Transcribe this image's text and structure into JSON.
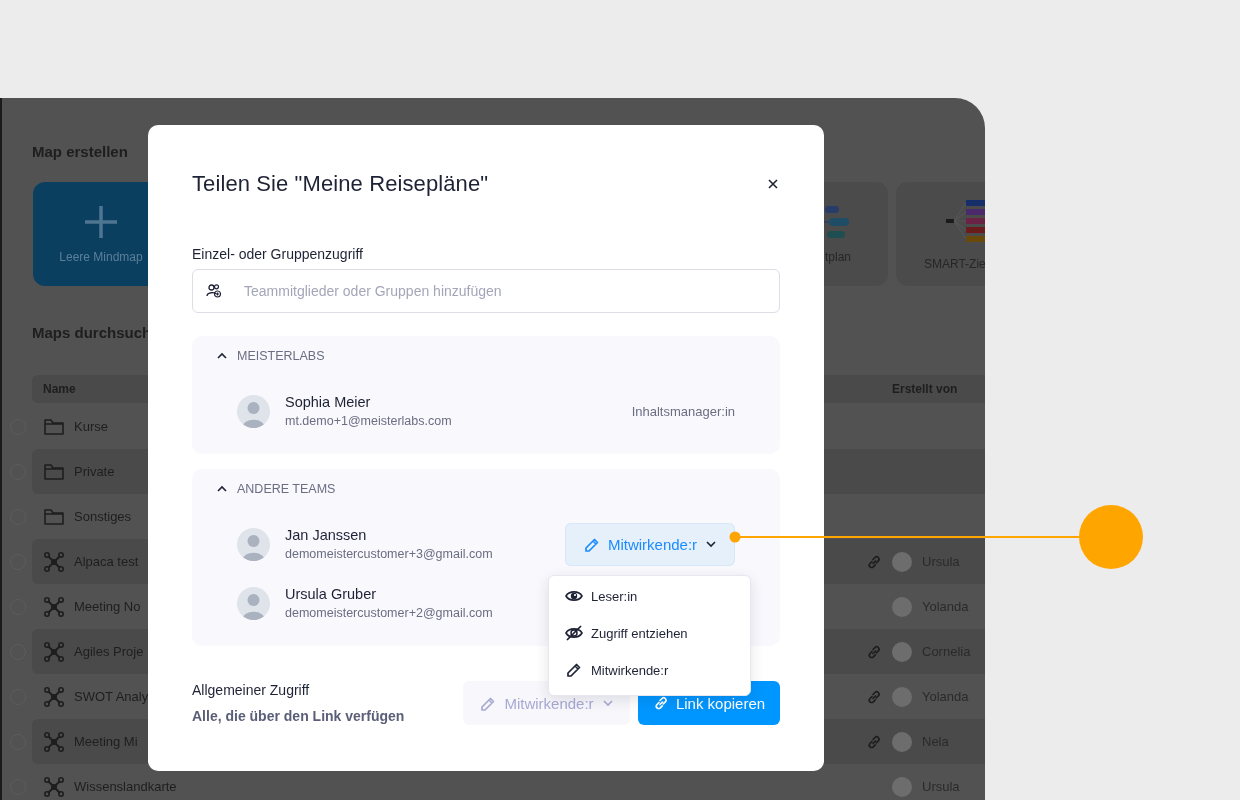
{
  "background_app": {
    "create_title": "Map erstellen",
    "templates": [
      {
        "kind": "blank",
        "label": "Leere Mindmap"
      },
      {
        "kind": "plan",
        "label": "tplan"
      },
      {
        "kind": "smart",
        "label": "SMART-Zie"
      }
    ],
    "browse_title": "Maps durchsuch",
    "table": {
      "columns": [
        "Name",
        "Erstellt von"
      ],
      "rows": [
        {
          "kind": "folder",
          "name": "Kurse",
          "shared": false,
          "checked": false
        },
        {
          "kind": "folder",
          "name": "Private",
          "shared": false,
          "checked": false
        },
        {
          "kind": "folder",
          "name": "Sonstiges",
          "shared": false,
          "checked": false
        },
        {
          "kind": "map",
          "name": "Alpaca test",
          "shared": true,
          "creator": "Ursula",
          "checked": false
        },
        {
          "kind": "map",
          "name": "Meeting No",
          "shared": false,
          "creator": "Yolanda",
          "checked": false
        },
        {
          "kind": "map",
          "name": "Agiles Proje",
          "shared": true,
          "creator": "Cornelia",
          "checked": false
        },
        {
          "kind": "map",
          "name": "SWOT Analy",
          "shared": true,
          "creator": "Yolanda",
          "checked": false
        },
        {
          "kind": "map",
          "name": "Meeting Mi",
          "shared": true,
          "creator": "Nela",
          "checked": false
        },
        {
          "kind": "map",
          "name": "Wissenslandkarte",
          "shared": false,
          "creator": "Ursula",
          "checked": false
        }
      ]
    }
  },
  "dialog": {
    "title": "Teilen Sie \"Meine Reisepläne\"",
    "access_label": "Einzel- oder Gruppenzugriff",
    "search": {
      "placeholder": "Teammitglieder oder Gruppen hinzufügen"
    },
    "groups": [
      {
        "name": "MEISTERLABS",
        "expanded": true,
        "members": [
          {
            "name": "Sophia Meier",
            "email": "mt.demo+1@meisterlabs.com",
            "role": {
              "kind": "label",
              "text": "Inhaltsmanager:in"
            }
          }
        ]
      },
      {
        "name": "ANDERE TEAMS",
        "expanded": true,
        "members": [
          {
            "name": "Jan Janssen",
            "email": "demomeistercustomer+3@gmail.com",
            "role": {
              "kind": "dropdown",
              "text": "Mitwirkende:r",
              "expanded": true,
              "menu": [
                {
                  "kind": "viewer",
                  "label": "Leser:in"
                },
                {
                  "kind": "revoke",
                  "label": "Zugriff entziehen"
                },
                {
                  "kind": "editor",
                  "label": "Mitwirkende:r"
                }
              ]
            }
          },
          {
            "name": "Ursula Gruber",
            "email": "demomeistercustomer+2@gmail.com"
          }
        ]
      }
    ],
    "general_access": {
      "title": "Allgemeiner Zugriff",
      "description": "Alle, die über den Link verfügen",
      "role": {
        "text": "Mitwirkende:r",
        "disabled": true
      },
      "copy_button": "Link kopieren"
    }
  }
}
